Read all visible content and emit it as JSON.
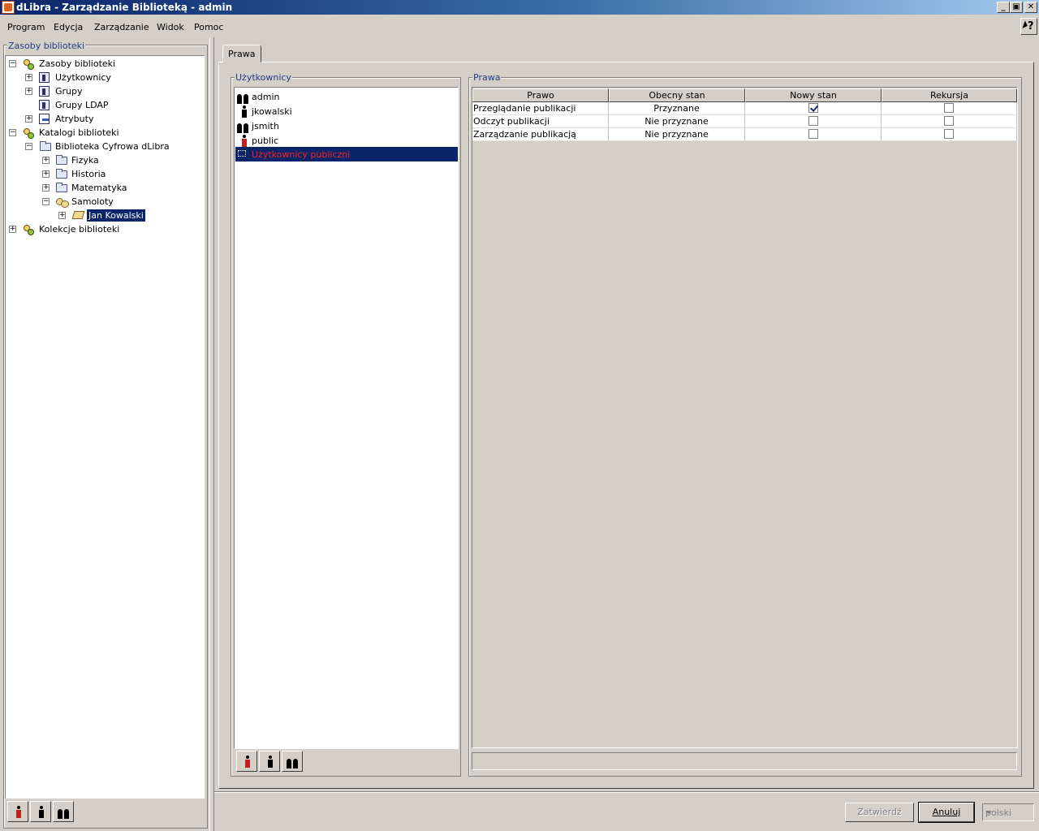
{
  "window": {
    "title": "dLibra - Zarządzanie Biblioteką - admin",
    "minimize": "_",
    "maximize": "▣",
    "close": "✕"
  },
  "menu": [
    "Program",
    "Edycja",
    "Zarządzanie",
    "Widok",
    "Pomoc"
  ],
  "help_button": "?",
  "left_panel": {
    "title": "Zasoby biblioteki",
    "tree": [
      {
        "label": "Zasoby biblioteki",
        "icon": "resources-icon",
        "expander": "−"
      },
      {
        "label": "Użytkownicy",
        "icon": "users-icon",
        "expander": "+"
      },
      {
        "label": "Grupy",
        "icon": "groups-icon",
        "expander": "+"
      },
      {
        "label": "Grupy LDAP",
        "icon": "ldap-groups-icon",
        "expander": ""
      },
      {
        "label": "Atrybuty",
        "icon": "attributes-icon",
        "expander": "+"
      },
      {
        "label": "Katalogi biblioteki",
        "icon": "catalogs-icon",
        "expander": "−"
      },
      {
        "label": "Biblioteka Cyfrowa dLibra",
        "icon": "folder-icon",
        "expander": "−"
      },
      {
        "label": "Fizyka",
        "icon": "folder-icon",
        "expander": "+"
      },
      {
        "label": "Historia",
        "icon": "folder-icon",
        "expander": "+"
      },
      {
        "label": "Matematyka",
        "icon": "folder-icon",
        "expander": "+"
      },
      {
        "label": "Samoloty",
        "icon": "collection-icon",
        "expander": "−"
      },
      {
        "label": "Jan Kowalski",
        "icon": "publication-icon",
        "expander": "+"
      },
      {
        "label": "Kolekcje biblioteki",
        "icon": "collections-icon",
        "expander": "+"
      }
    ]
  },
  "tab": {
    "label": "Prawa"
  },
  "users_panel": {
    "title": "Użytkownicy",
    "items": [
      {
        "label": "admin",
        "icon": "admin-user-icon"
      },
      {
        "label": "jkowalski",
        "icon": "user-icon"
      },
      {
        "label": "jsmith",
        "icon": "admin-user-icon"
      },
      {
        "label": "public",
        "icon": "public-user-icon"
      },
      {
        "label": "Użytkownicy publiczni",
        "icon": "public-users-icon"
      }
    ]
  },
  "rights_panel": {
    "title": "Prawa",
    "columns": [
      "Prawo",
      "Obecny stan",
      "Nowy stan",
      "Rekursja"
    ],
    "rows": [
      {
        "right": "Przeglądanie publikacji",
        "current": "Przyznane",
        "new_state": true,
        "recursion": false
      },
      {
        "right": "Odczyt publikacji",
        "current": "Nie przyznane",
        "new_state": false,
        "recursion": false
      },
      {
        "right": "Zarządzanie publikacją",
        "current": "Nie przyznane",
        "new_state": false,
        "recursion": false
      }
    ]
  },
  "buttons": {
    "confirm": "Zatwierdź",
    "cancel": "Anuluj"
  },
  "language": {
    "selected": "polski"
  }
}
